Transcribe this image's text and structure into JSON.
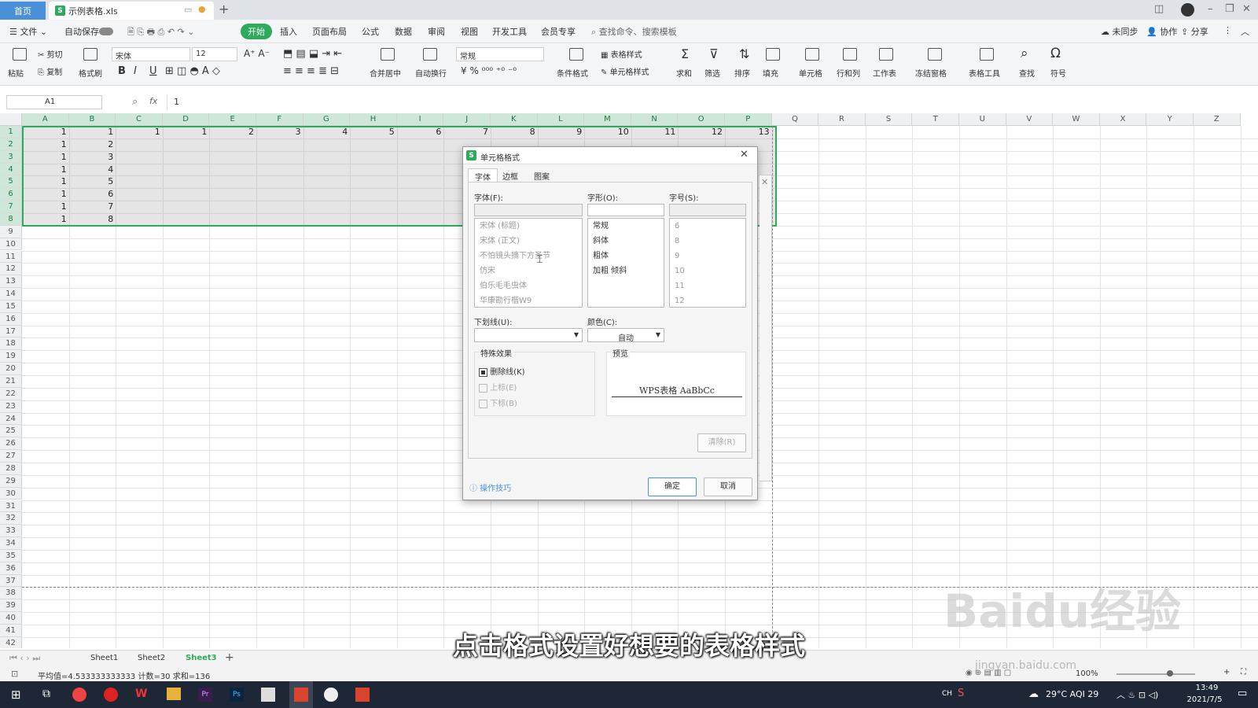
{
  "app": {
    "home_tab": "首页",
    "file_tab": "示例表格.xls"
  },
  "menu": {
    "file": "文件",
    "autosave": "自动保存",
    "items": [
      "开始",
      "插入",
      "页面布局",
      "公式",
      "数据",
      "审阅",
      "视图",
      "开发工具",
      "会员专享"
    ],
    "search": "查找命令、搜索模板",
    "sync": "未同步",
    "collab": "协作",
    "share": "分享"
  },
  "ribbon": {
    "paste": "粘贴",
    "cut": "剪切",
    "copy": "复制",
    "format_painter": "格式刷",
    "font": "宋体",
    "size": "12",
    "merge": "合并居中",
    "wrap": "自动换行",
    "numfmt": "常规",
    "table_style": "表格样式",
    "cond_format": "条件格式",
    "cell_style": "单元格样式",
    "sum": "求和",
    "filter": "筛选",
    "sort": "排序",
    "fill": "填充",
    "cells": "单元格",
    "rowcol": "行和列",
    "worksheet": "工作表",
    "freeze": "冻结窗格",
    "tools": "表格工具",
    "find": "查找",
    "symbol": "符号"
  },
  "formula": {
    "cellref": "A1",
    "fx": "fx",
    "value": "1"
  },
  "columns": [
    "A",
    "B",
    "C",
    "D",
    "E",
    "F",
    "G",
    "H",
    "I",
    "J",
    "K",
    "L",
    "M",
    "N",
    "O",
    "P",
    "Q",
    "R",
    "S",
    "T",
    "U",
    "V",
    "W",
    "X",
    "Y",
    "Z"
  ],
  "rows": [
    "1",
    "2",
    "3",
    "4",
    "5",
    "6",
    "7",
    "8",
    "9",
    "10",
    "11",
    "12",
    "13",
    "14",
    "15",
    "16",
    "17",
    "18",
    "19",
    "20",
    "21",
    "22",
    "23",
    "24",
    "25",
    "26",
    "27",
    "28",
    "29",
    "30",
    "31",
    "32",
    "33",
    "34",
    "35",
    "36",
    "37",
    "38",
    "39",
    "40",
    "41",
    "42"
  ],
  "row1_values": [
    "1",
    "1",
    "1",
    "1",
    "2",
    "3",
    "4",
    "5",
    "6",
    "7",
    "8",
    "9",
    "10",
    "11",
    "12",
    "13"
  ],
  "colA_values": [
    "1",
    "1",
    "1",
    "1",
    "1",
    "1",
    "1"
  ],
  "colB_values": [
    "2",
    "3",
    "4",
    "5",
    "6",
    "7",
    "8"
  ],
  "dialog": {
    "title": "单元格格式",
    "tabs": [
      "字体",
      "边框",
      "图案"
    ],
    "font_label": "字体(F):",
    "style_label": "字形(O):",
    "size_label": "字号(S):",
    "fonts": [
      "宋体 (标题)",
      "宋体 (正文)",
      "不怕镜头摘下方圣节",
      "仿宋",
      "伯乐毛毛虫体",
      "华康勘行楷W9"
    ],
    "styles": [
      "常规",
      "斜体",
      "粗体",
      "加粗 倾斜"
    ],
    "sizes": [
      "6",
      "8",
      "9",
      "10",
      "11",
      "12"
    ],
    "underline_label": "下划线(U):",
    "color_label": "颜色(C):",
    "color_value": "自动",
    "effects_label": "特殊效果",
    "strike": "删除线(K)",
    "superscript": "上标(E)",
    "subscript": "下标(B)",
    "preview_label": "预览",
    "preview_text": "WPS表格  AaBbCc",
    "clear": "清除(R)",
    "tips": "操作技巧",
    "ok": "确定",
    "cancel": "取消"
  },
  "sheets": [
    "Sheet1",
    "Sheet2",
    "Sheet3"
  ],
  "status": {
    "summary": "平均值=4.533333333333  计数=30  求和=136",
    "zoom": "100%"
  },
  "taskbar": {
    "ime": "CH",
    "weather": "29°C  AQI 29",
    "time": "13:49",
    "date": "2021/7/5"
  },
  "subtitle": "点击格式设置好想要的表格样式",
  "watermark": "Baidu经验",
  "watermark_url": "jingyan.baidu.com",
  "colors": {
    "accent": "#2eaa5c",
    "blue": "#4a90d9"
  }
}
